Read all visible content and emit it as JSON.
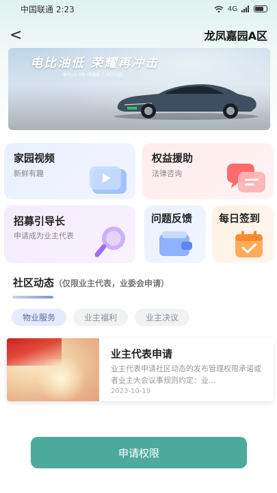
{
  "status_bar": {
    "carrier_time": "中国联通 2:23",
    "signal": "4G"
  },
  "header": {
    "back_label": "<",
    "title": "龙凤嘉园A区"
  },
  "banner": {
    "headline": "电比油低 荣耀再冲击",
    "subtext": "秦PLUS DM-i荣耀版 7.98万元起"
  },
  "cards": [
    {
      "title": "家园视频",
      "subtitle": "新鲜有趣",
      "icon": "video-play-icon"
    },
    {
      "title": "权益援助",
      "subtitle": "法律咨询",
      "icon": "chat-bubbles-icon"
    },
    {
      "title": "招募引导长",
      "subtitle": "申请成为业主代表",
      "icon": "magnifier-icon"
    },
    {
      "title": "问题反馈",
      "icon": "wallet-icon"
    },
    {
      "title": "每日签到",
      "icon": "calendar-check-icon"
    }
  ],
  "section": {
    "title": "社区动态",
    "note": "（仅限业主代表，业委会申请）"
  },
  "tabs": [
    {
      "label": "物业服务",
      "active": true
    },
    {
      "label": "业主福利",
      "active": false
    },
    {
      "label": "业主决议",
      "active": false
    }
  ],
  "article": {
    "title": "业主代表申请",
    "description": "业主代表申请社区动态的发布管理权限承诺或者业主大会议事规则约定：业…",
    "date": "2023-10-19"
  },
  "apply_button": {
    "label": "申请权限"
  },
  "colors": {
    "accent": "#4dab9c",
    "tab_active": "#e4ebfa"
  }
}
